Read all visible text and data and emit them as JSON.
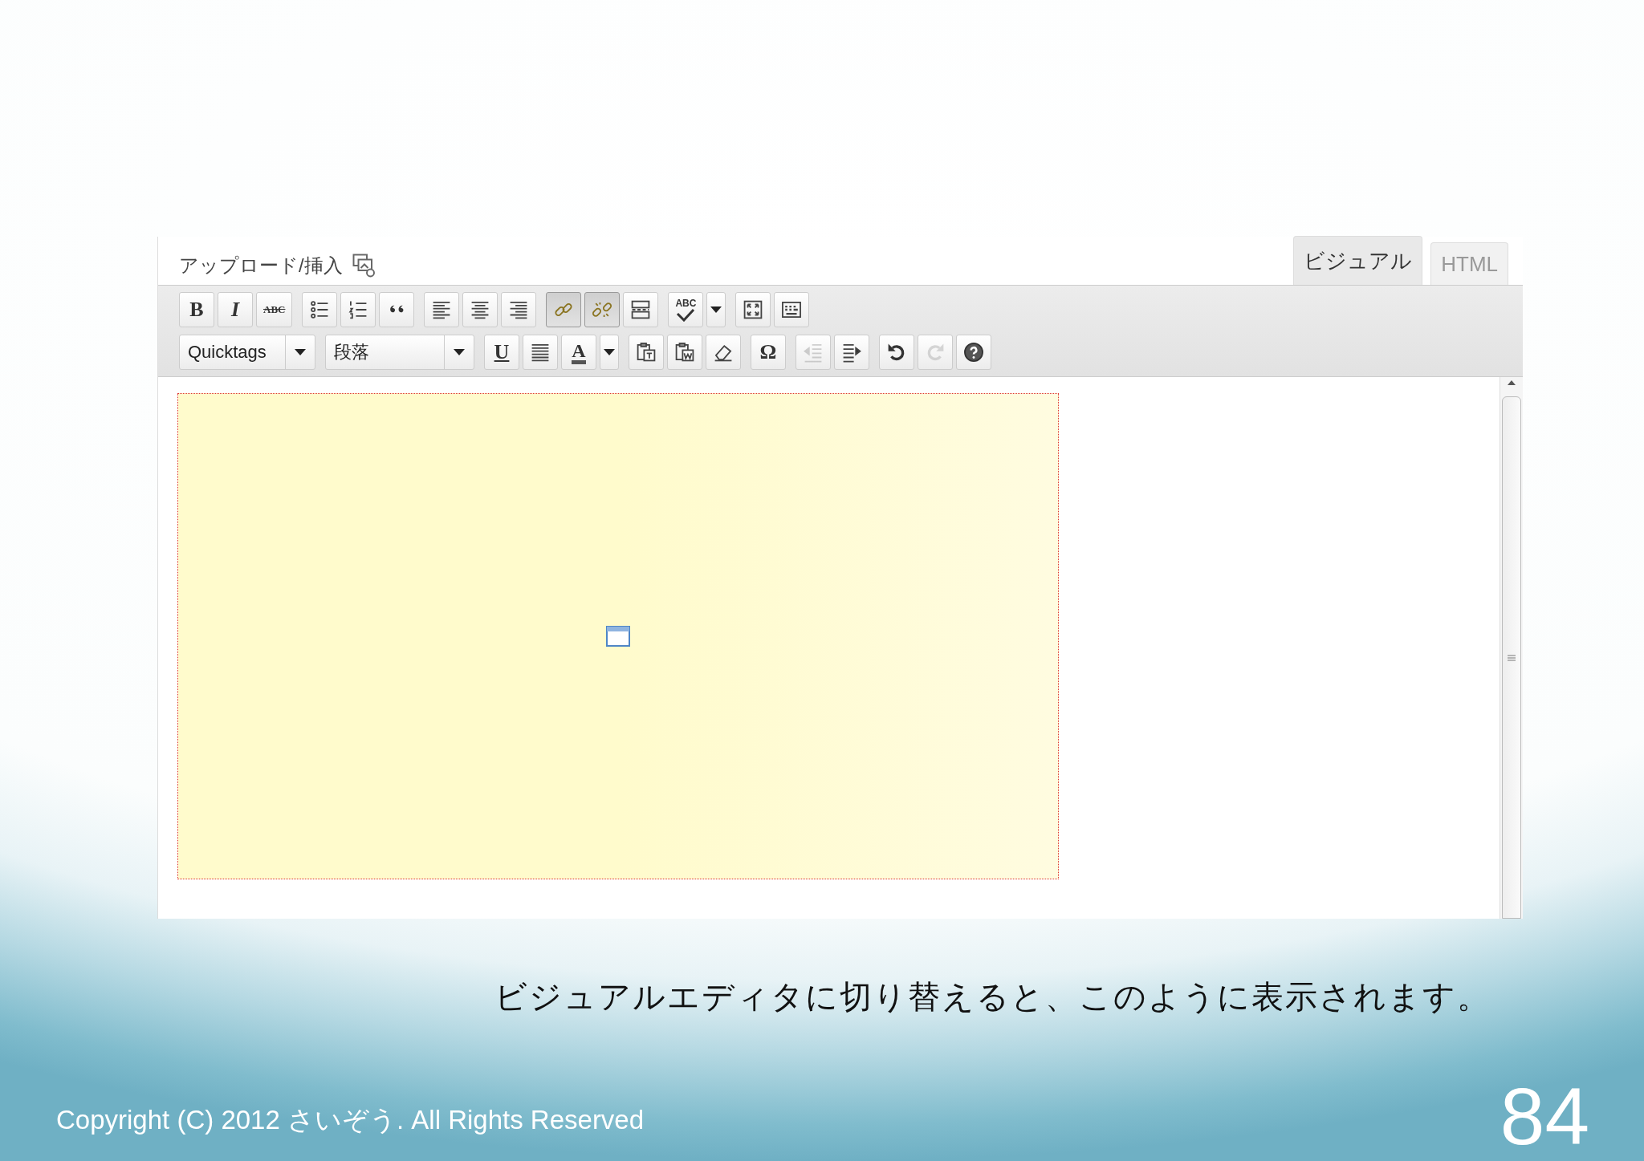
{
  "editor": {
    "upload_label": "アップロード/挿入",
    "tabs": [
      {
        "label": "ビジュアル",
        "selected": true
      },
      {
        "label": "HTML",
        "selected": false
      }
    ],
    "toolbar_rows": [
      [
        [
          {
            "kind": "bold",
            "label": "B",
            "pressed": false,
            "disabled": false
          },
          {
            "kind": "italic",
            "label": "I",
            "pressed": false,
            "disabled": false
          },
          {
            "kind": "strike",
            "label": "ABC",
            "pressed": false,
            "disabled": false
          }
        ],
        [
          {
            "kind": "icon",
            "pressed": false,
            "disabled": false
          },
          {
            "kind": "icon",
            "pressed": false,
            "disabled": false
          },
          {
            "kind": "icon",
            "pressed": false,
            "disabled": false
          }
        ],
        [
          {
            "kind": "icon",
            "pressed": false,
            "disabled": false
          },
          {
            "kind": "icon",
            "pressed": false,
            "disabled": false
          },
          {
            "kind": "icon",
            "pressed": false,
            "disabled": false
          }
        ],
        [
          {
            "kind": "icon",
            "pressed": true,
            "disabled": false
          },
          {
            "kind": "icon",
            "pressed": true,
            "disabled": false
          },
          {
            "kind": "icon",
            "pressed": false,
            "disabled": false
          }
        ],
        [
          {
            "kind": "spell",
            "label": "ABC",
            "pressed": false,
            "disabled": false
          },
          {
            "kind": "arrow",
            "pressed": false,
            "disabled": false
          }
        ],
        [
          {
            "kind": "icon",
            "pressed": false,
            "disabled": false
          },
          {
            "kind": "icon",
            "pressed": false,
            "disabled": false
          }
        ]
      ],
      [
        [
          {
            "kind": "select",
            "value": "Quicktags"
          }
        ],
        [
          {
            "kind": "select",
            "value": "段落"
          }
        ],
        [
          {
            "kind": "underline",
            "label": "U",
            "pressed": false,
            "disabled": false
          },
          {
            "kind": "icon",
            "pressed": false,
            "disabled": false
          },
          {
            "kind": "color",
            "label": "A",
            "pressed": false,
            "disabled": false
          },
          {
            "kind": "arrow",
            "pressed": false,
            "disabled": false
          }
        ],
        [
          {
            "kind": "icon",
            "pressed": false,
            "disabled": false
          },
          {
            "kind": "icon",
            "pressed": false,
            "disabled": false
          },
          {
            "kind": "icon",
            "pressed": false,
            "disabled": false
          }
        ],
        [
          {
            "kind": "symbol",
            "label": "Ω",
            "pressed": false,
            "disabled": false
          }
        ],
        [
          {
            "kind": "icon",
            "pressed": false,
            "disabled": true
          },
          {
            "kind": "icon",
            "pressed": false,
            "disabled": false
          }
        ],
        [
          {
            "kind": "icon",
            "pressed": false,
            "disabled": false
          },
          {
            "kind": "icon",
            "pressed": false,
            "disabled": true
          },
          {
            "kind": "icon",
            "pressed": false,
            "disabled": false
          }
        ]
      ]
    ]
  },
  "caption": "ビジュアルエディタに切り替えると、このように表示されます。",
  "footer": {
    "copyright": "Copyright (C) 2012 さいぞう. All Rights Reserved",
    "page_number": "84"
  }
}
